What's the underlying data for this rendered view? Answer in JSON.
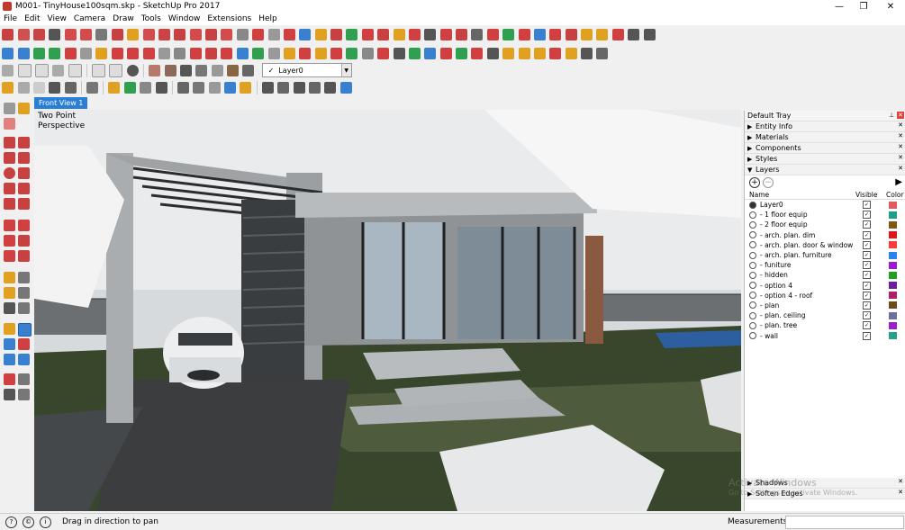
{
  "window": {
    "title": "M001- TinyHouse100sqm.skp - SketchUp Pro 2017",
    "minimize": "—",
    "restore": "❐",
    "close": "✕"
  },
  "menu": [
    "File",
    "Edit",
    "View",
    "Camera",
    "Draw",
    "Tools",
    "Window",
    "Extensions",
    "Help"
  ],
  "toolbar": {
    "layer_selected": "Layer0",
    "layer_check": "✓"
  },
  "scene_tab": "Front View 1",
  "viewport": {
    "perspective_label": "Two Point\nPerspective"
  },
  "tray": {
    "title": "Default Tray",
    "pin": "⊥",
    "close": "✕",
    "panels_top": [
      {
        "label": "Entity Info",
        "expanded": false
      },
      {
        "label": "Materials",
        "expanded": false
      },
      {
        "label": "Components",
        "expanded": false
      },
      {
        "label": "Styles",
        "expanded": false
      },
      {
        "label": "Layers",
        "expanded": true
      }
    ],
    "panels_bottom": [
      {
        "label": "Shadows",
        "expanded": false
      },
      {
        "label": "Soften Edges",
        "expanded": false
      }
    ],
    "layers": {
      "add_icon": "+",
      "remove_icon": "−",
      "details_icon": "▶",
      "col_name": "Name",
      "col_visible": "Visible",
      "col_color": "Color",
      "rows": [
        {
          "name": "Layer0",
          "active": true,
          "visible": true,
          "color": "#e15b5b"
        },
        {
          "name": "- 1 floor equip",
          "active": false,
          "visible": true,
          "color": "#1aa08a"
        },
        {
          "name": "- 2 floor equip",
          "active": false,
          "visible": true,
          "color": "#7a5a14"
        },
        {
          "name": "- arch. plan. dim",
          "active": false,
          "visible": true,
          "color": "#e01515"
        },
        {
          "name": "- arch. plan. door & window",
          "active": false,
          "visible": true,
          "color": "#ff3a3a"
        },
        {
          "name": "- arch. plan. furniture",
          "active": false,
          "visible": true,
          "color": "#2a82f0"
        },
        {
          "name": "- funiture",
          "active": false,
          "visible": true,
          "color": "#9a19d8"
        },
        {
          "name": "- hidden",
          "active": false,
          "visible": true,
          "color": "#20a020"
        },
        {
          "name": "- option 4",
          "active": false,
          "visible": true,
          "color": "#6b1fa0"
        },
        {
          "name": "- option 4 - roof",
          "active": false,
          "visible": true,
          "color": "#b01d6a"
        },
        {
          "name": "- plan",
          "active": false,
          "visible": true,
          "color": "#6f4a1c"
        },
        {
          "name": "- plan. ceiling",
          "active": false,
          "visible": true,
          "color": "#6e6e9a"
        },
        {
          "name": "- plan. tree",
          "active": false,
          "visible": true,
          "color": "#9a20c8"
        },
        {
          "name": "- wall",
          "active": false,
          "visible": true,
          "color": "#26a08a"
        }
      ]
    }
  },
  "statusbar": {
    "hint": "Drag in direction to pan",
    "measurements_label": "Measurements",
    "measurements_value": ""
  },
  "watermark": {
    "line1": "Activate Windows",
    "line2": "Go to Settings to activate Windows."
  }
}
